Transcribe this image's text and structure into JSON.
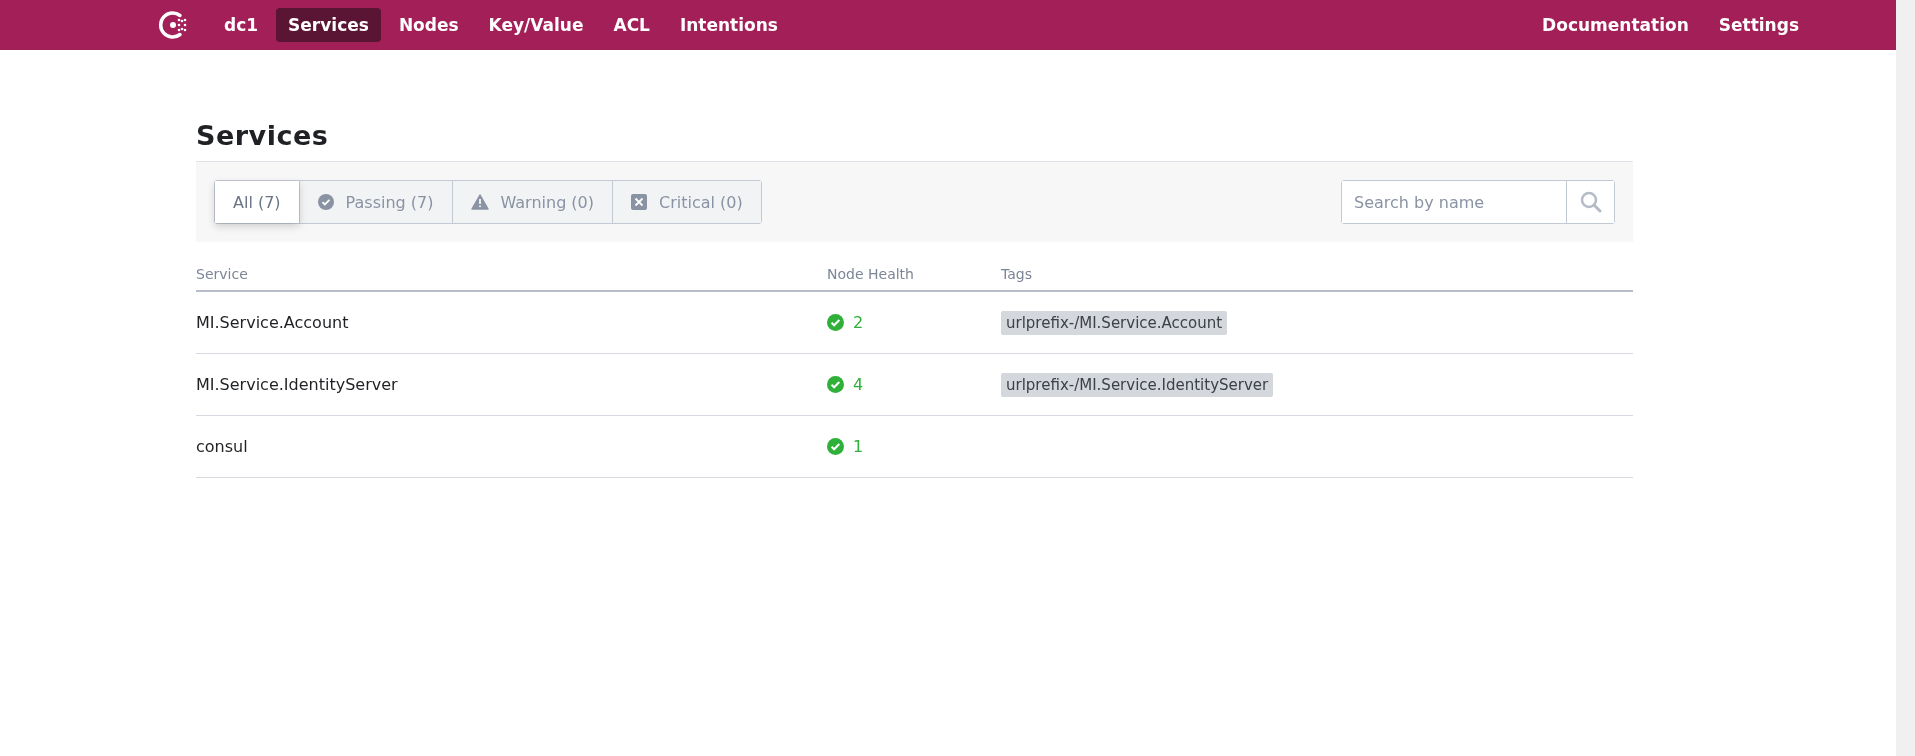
{
  "nav": {
    "datacenter": "dc1",
    "items": [
      {
        "label": "Services",
        "selected": true
      },
      {
        "label": "Nodes",
        "selected": false
      },
      {
        "label": "Key/Value",
        "selected": false
      },
      {
        "label": "ACL",
        "selected": false
      },
      {
        "label": "Intentions",
        "selected": false
      }
    ],
    "right_items": [
      "Documentation",
      "Settings"
    ]
  },
  "page_title": "Services",
  "filters": [
    {
      "kind": "all",
      "label": "All (7)",
      "selected": true
    },
    {
      "kind": "passing",
      "label": "Passing (7)",
      "selected": false
    },
    {
      "kind": "warning",
      "label": "Warning (0)",
      "selected": false
    },
    {
      "kind": "critical",
      "label": "Critical (0)",
      "selected": false
    }
  ],
  "search": {
    "placeholder": "Search by name"
  },
  "table": {
    "columns": [
      "Service",
      "Node Health",
      "Tags"
    ],
    "rows": [
      {
        "service": "MI.Service.Account",
        "kind": "passing",
        "count": "2",
        "tags": [
          "urlprefix-/MI.Service.Account"
        ]
      },
      {
        "service": "MI.Service.IdentityServer",
        "kind": "passing",
        "count": "4",
        "tags": [
          "urlprefix-/MI.Service.IdentityServer"
        ]
      },
      {
        "service": "consul",
        "kind": "passing",
        "count": "1",
        "tags": []
      }
    ]
  }
}
